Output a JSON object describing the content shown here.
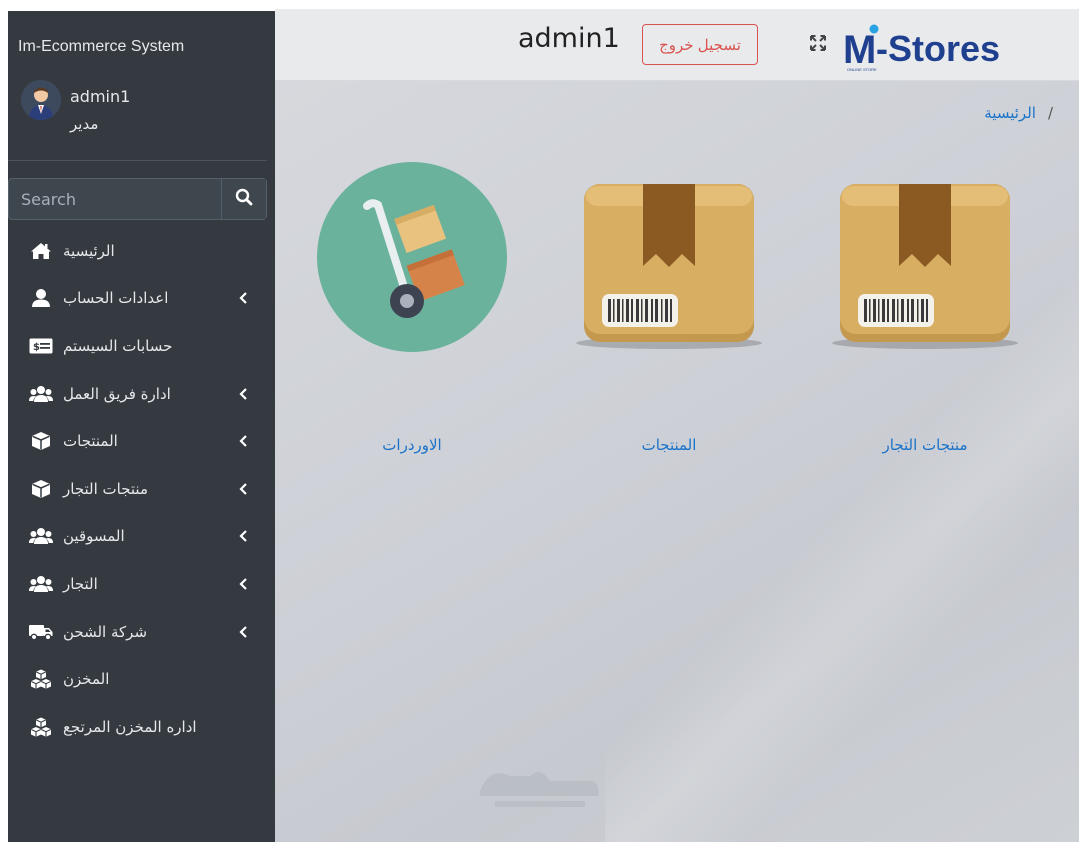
{
  "sidebar": {
    "brand": "Im-Ecommerce System",
    "user": {
      "name": "admin1",
      "role": "مدير"
    },
    "search": {
      "placeholder": "Search"
    },
    "items": [
      {
        "label": "الرئيسية",
        "icon": "home-icon",
        "has_submenu": false
      },
      {
        "label": "اعدادات الحساب",
        "icon": "user-icon",
        "has_submenu": true
      },
      {
        "label": "حسابات السيستم",
        "icon": "money-bill-icon",
        "has_submenu": false
      },
      {
        "label": "ادارة فريق العمل",
        "icon": "users-icon",
        "has_submenu": true
      },
      {
        "label": "المنتجات",
        "icon": "box-icon",
        "has_submenu": true
      },
      {
        "label": "منتجات التجار",
        "icon": "box-icon",
        "has_submenu": true
      },
      {
        "label": "المسوقين",
        "icon": "users-icon",
        "has_submenu": true
      },
      {
        "label": "التجار",
        "icon": "users-icon",
        "has_submenu": true
      },
      {
        "label": "شركة الشحن",
        "icon": "truck-icon",
        "has_submenu": true
      },
      {
        "label": "المخزن",
        "icon": "boxes-icon",
        "has_submenu": false
      },
      {
        "label": "اداره المخزن المرتجع",
        "icon": "boxes-icon",
        "has_submenu": false
      }
    ]
  },
  "topbar": {
    "admin_name": "admin1",
    "logout_label": "تسجيل خروج",
    "logo_text": "-Stores",
    "logo_letter": "M",
    "logo_tagline": "ONLINE STORE",
    "accent_color": "#1f3f8f",
    "logout_color": "#d9534f"
  },
  "main": {
    "breadcrumb": {
      "separator": "/",
      "current": "الرئيسية"
    },
    "tiles": [
      {
        "label": "منتجات التجار",
        "icon": "package-box-icon"
      },
      {
        "label": "المنتجات",
        "icon": "package-box-icon"
      },
      {
        "label": "الاوردرات",
        "icon": "hand-truck-icon"
      }
    ],
    "link_color": "#1a73c9"
  }
}
